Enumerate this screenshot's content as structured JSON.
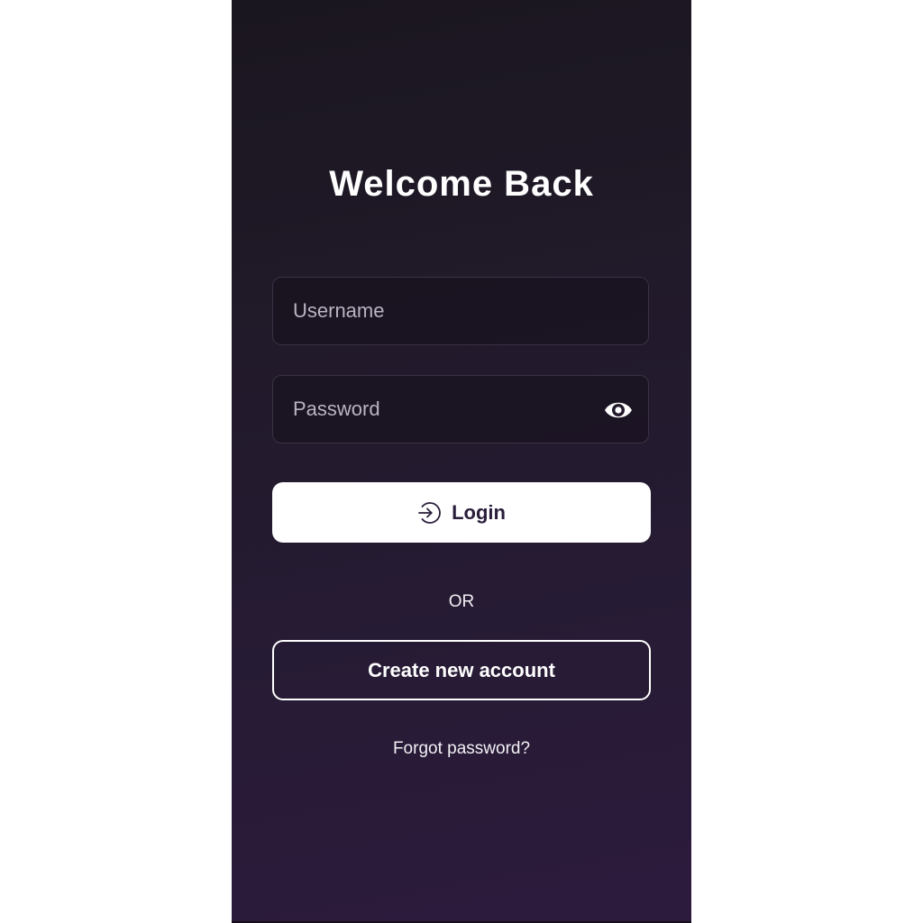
{
  "screen": {
    "title": "Welcome Back"
  },
  "form": {
    "username": {
      "value": "",
      "placeholder": "Username"
    },
    "password": {
      "value": "",
      "placeholder": "Password",
      "toggle_icon": "eye-icon"
    }
  },
  "actions": {
    "login_label": "Login",
    "login_icon": "login-arrow-icon",
    "divider_text": "OR",
    "create_account_label": "Create new account",
    "forgot_password_label": "Forgot password?"
  },
  "colors": {
    "background_top": "#1a161f",
    "background_bottom": "#2d1b3d",
    "primary_button_bg": "#ffffff",
    "primary_button_text": "#2a1d3a",
    "text": "#ffffff"
  }
}
